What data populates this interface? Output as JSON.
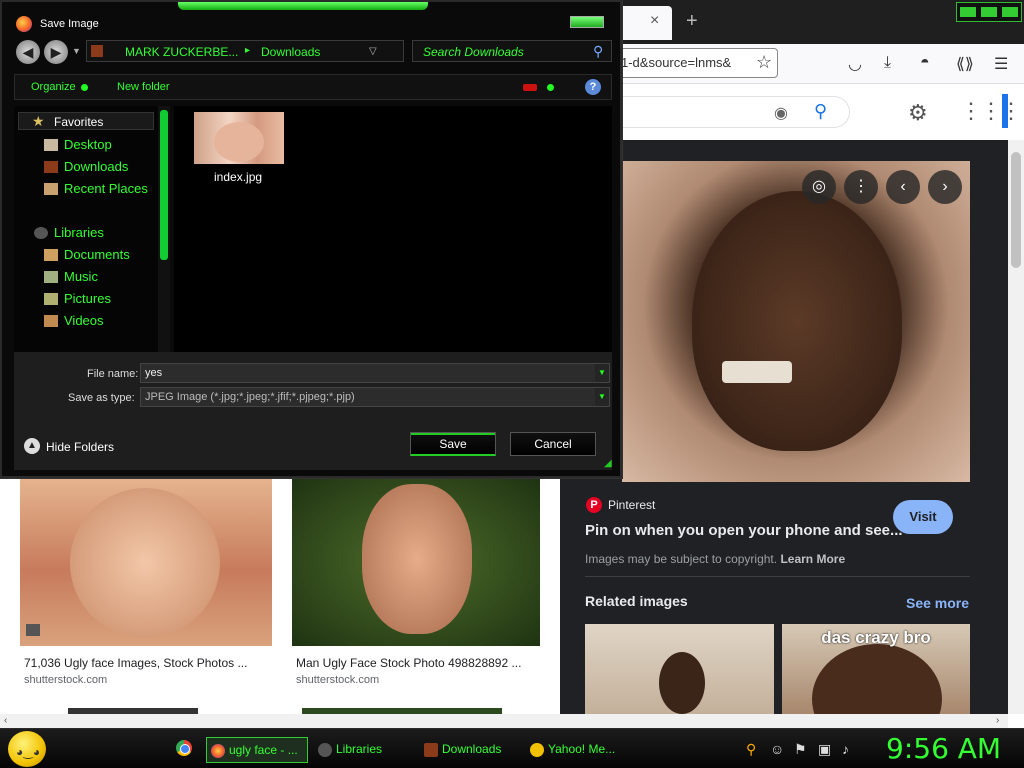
{
  "browser": {
    "url_fragment": "1-d&source=lnms&",
    "tab_close": "×",
    "new_tab": "+"
  },
  "results": [
    {
      "title": "71,036 Ugly face Images, Stock Photos ...",
      "source": "shutterstock.com"
    },
    {
      "title": "Man Ugly Face Stock Photo 498828892 ...",
      "source": "shutterstock.com"
    }
  ],
  "preview": {
    "source_name": "Pinterest",
    "title": "Pin on when you open your phone and see...",
    "visit_label": "Visit",
    "copyright_text": "Images may be subject to copyright.",
    "learn_more": "Learn More",
    "related_title": "Related images",
    "see_more": "See more",
    "related_caption": "das crazy bro"
  },
  "dialog": {
    "title": "Save Image",
    "address": {
      "segment1": "MARK ZUCKERBE...",
      "separator": "▸",
      "segment2": "Downloads"
    },
    "search_placeholder": "Search Downloads",
    "toolbar": {
      "organize": "Organize",
      "new_folder": "New folder"
    },
    "nav": {
      "favorites": "Favorites",
      "desktop": "Desktop",
      "downloads": "Downloads",
      "recent_places": "Recent Places",
      "libraries": "Libraries",
      "documents": "Documents",
      "music": "Music",
      "pictures": "Pictures",
      "videos": "Videos"
    },
    "file": {
      "name": "index.jpg"
    },
    "file_name_label": "File name:",
    "file_name_value": "yes",
    "save_type_label": "Save as type:",
    "save_type_value": "JPEG Image (*.jpg;*.jpeg;*.jfif;*.pjpeg;*.pjp)",
    "hide_folders": "Hide Folders",
    "save_button": "Save",
    "cancel_button": "Cancel"
  },
  "taskbar": {
    "items": [
      "ugly face - ...",
      "Libraries",
      "Downloads",
      "Yahoo! Me..."
    ],
    "clock": "9:56 AM"
  },
  "colors": {
    "accent_green": "#33ff33",
    "google_blue": "#8ab4f8"
  }
}
